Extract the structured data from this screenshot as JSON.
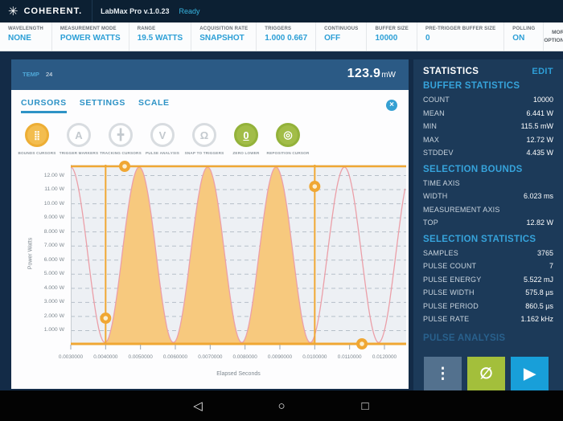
{
  "titlebar": {
    "brand": "COHERENT.",
    "app_title": "LabMax Pro v.1.0.23",
    "status": "Ready"
  },
  "toolbar": {
    "items": [
      {
        "label": "WAVELENGTH",
        "value": "NONE"
      },
      {
        "label": "MEASUREMENT MODE",
        "value": "POWER WATTS"
      },
      {
        "label": "RANGE",
        "value": "19.5 WATTS"
      },
      {
        "label": "ACQUISITION RATE",
        "value": "SNAPSHOT"
      },
      {
        "label": "TRIGGERS",
        "value": "1.000 0.667"
      },
      {
        "label": "CONTINUOUS",
        "value": "OFF"
      },
      {
        "label": "BUFFER SIZE",
        "value": "10000"
      },
      {
        "label": "PRE-TRIGGER BUFFER SIZE",
        "value": "0"
      },
      {
        "label": "POLLING",
        "value": "ON"
      }
    ],
    "more_options": "MORE OPTIONS"
  },
  "chart_panel": {
    "header": {
      "temp_label": "TEMP",
      "temp_value": "24",
      "reading_value": "123.9",
      "reading_unit": "mW"
    },
    "tabs": [
      "CURSORS",
      "SETTINGS",
      "SCALE"
    ],
    "active_tab": "CURSORS",
    "tools": [
      {
        "label": "BOUNDS CURSORS",
        "icon": "bounds-cursors",
        "state": "orange"
      },
      {
        "label": "TRIGGER MARKERS",
        "icon": "trigger-markers",
        "state": "gray"
      },
      {
        "label": "TRACKING CURSORS",
        "icon": "tracking-cursors",
        "state": "gray"
      },
      {
        "label": "PULSE ANALYSIS",
        "icon": "pulse-analysis",
        "state": "gray"
      },
      {
        "label": "SNAP TO TRIGGERS",
        "icon": "snap-to-triggers",
        "state": "gray"
      },
      {
        "label": "ZERO LOWER",
        "icon": "zero-lower",
        "state": "green"
      },
      {
        "label": "REPOSITION CURSOR",
        "icon": "reposition-cursor",
        "state": "green"
      }
    ]
  },
  "chart_data": {
    "type": "area",
    "xlabel": "Elapsed Seconds",
    "ylabel": "Power Watts",
    "x_start_s": 0.003,
    "x_end_s": 0.012623,
    "y_top_w": 12.77,
    "x_ticks": [
      {
        "t": 0.003,
        "label": "0.0030000"
      },
      {
        "t": 0.004,
        "label": "0.0040000"
      },
      {
        "t": 0.005,
        "label": "0.0050000"
      },
      {
        "t": 0.006,
        "label": "0.0060000"
      },
      {
        "t": 0.007,
        "label": "0.0070000"
      },
      {
        "t": 0.008,
        "label": "0.0080000"
      },
      {
        "t": 0.009,
        "label": "0.0090000"
      },
      {
        "t": 0.01,
        "label": "0.0100000"
      },
      {
        "t": 0.011,
        "label": "0.0110000"
      },
      {
        "t": 0.012,
        "label": "0.0120000"
      }
    ],
    "y_ticks": [
      {
        "w": 12,
        "label": "12.00 W"
      },
      {
        "w": 11,
        "label": "11.00 W"
      },
      {
        "w": 10,
        "label": "10.00 W"
      },
      {
        "w": 9,
        "label": "9.000 W"
      },
      {
        "w": 8,
        "label": "8.000 W"
      },
      {
        "w": 7,
        "label": "7.000 W"
      },
      {
        "w": 6,
        "label": "6.000 W"
      },
      {
        "w": 5,
        "label": "5.000 W"
      },
      {
        "w": 4,
        "label": "4.000 W"
      },
      {
        "w": 3,
        "label": "3.000 W"
      },
      {
        "w": 2,
        "label": "2.000 W"
      },
      {
        "w": 1,
        "label": "1.000 W"
      }
    ],
    "wave": {
      "mid_w": 6.375,
      "amp_w": 6.225,
      "period_s": 0.001963,
      "peak_t_s": 0.003
    },
    "selection": {
      "left_s": 0.004,
      "right_s": 0.01,
      "top_w": 12.82,
      "bottom_w": 0,
      "handles": {
        "left_cursor_w": 1.88,
        "right_cursor_w": 11.23,
        "top_t_s": 0.004546,
        "bottom_t_s": 0.011354
      }
    },
    "colors": {
      "fill": "#F7C97E",
      "line": "#EB9FA8",
      "bounds": "#F0A733",
      "grid": "#B6BFC9",
      "plot_bg": "#EDF0F4",
      "tick": "#9AA5AF"
    }
  },
  "stats_panel": {
    "title": "STATISTICS",
    "edit_label": "EDIT",
    "sections": [
      {
        "heading": "BUFFER STATISTICS",
        "style": "bright",
        "rows": [
          {
            "label": "COUNT",
            "value": "10000"
          },
          {
            "label": "MEAN",
            "value": "6.441 W"
          },
          {
            "label": "MIN",
            "value": "115.5 mW"
          },
          {
            "label": "MAX",
            "value": "12.72 W"
          },
          {
            "label": "STDDEV",
            "value": "4.435 W"
          }
        ]
      },
      {
        "heading": "SELECTION BOUNDS",
        "style": "bright",
        "rows": [
          {
            "label": "TIME AXIS",
            "value": ""
          },
          {
            "label": "WIDTH",
            "value": "6.023 ms"
          },
          {
            "label": "MEASUREMENT AXIS",
            "value": ""
          },
          {
            "label": "TOP",
            "value": "12.82 W"
          }
        ]
      },
      {
        "heading": "SELECTION STATISTICS",
        "style": "bright",
        "rows": [
          {
            "label": "SAMPLES",
            "value": "3765"
          },
          {
            "label": "PULSE COUNT",
            "value": "7"
          },
          {
            "label": "PULSE ENERGY",
            "value": "5.522 mJ"
          },
          {
            "label": "PULSE WIDTH",
            "value": "575.8 µs"
          },
          {
            "label": "PULSE PERIOD",
            "value": "860.5 µs"
          },
          {
            "label": "PULSE RATE",
            "value": "1.162 kHz"
          }
        ]
      },
      {
        "heading": "PULSE ANALYSIS",
        "style": "dim",
        "rows": []
      }
    ],
    "buttons": [
      {
        "name": "more-actions",
        "icon": "kebab-icon",
        "color": "#53718E"
      },
      {
        "name": "zero",
        "icon": "null-icon",
        "color": "#A3BF3B"
      },
      {
        "name": "start",
        "icon": "play-icon",
        "color": "#189FD9"
      }
    ]
  },
  "navbar": {
    "items": [
      {
        "name": "back",
        "icon": "back-icon"
      },
      {
        "name": "home",
        "icon": "home-icon"
      },
      {
        "name": "recents",
        "icon": "recents-icon"
      }
    ]
  }
}
